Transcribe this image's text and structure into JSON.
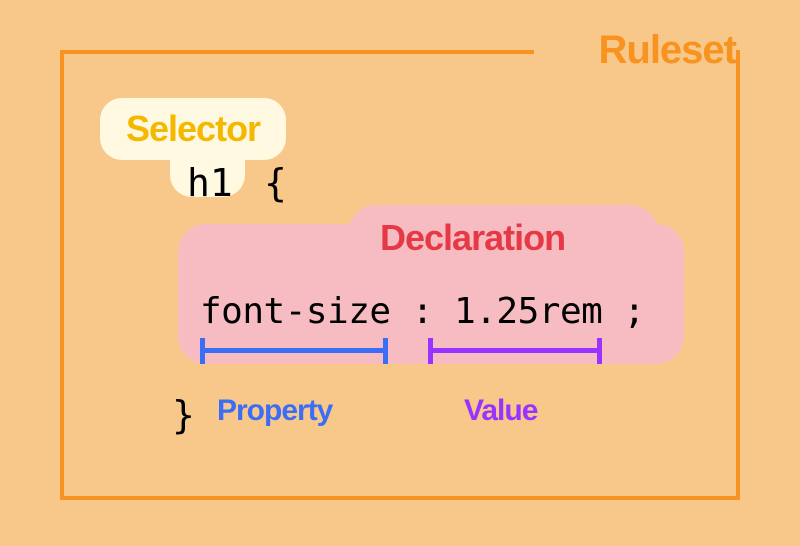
{
  "labels": {
    "ruleset": "Ruleset",
    "selector": "Selector",
    "declaration": "Declaration",
    "property": "Property",
    "value": "Value"
  },
  "code": {
    "selector": "h1",
    "brace_open": "{",
    "declaration": "font-size : 1.25rem ;",
    "brace_close": "}",
    "property": "font-size",
    "value": "1.25rem"
  },
  "colors": {
    "background": "#f8c88a",
    "ruleset_border": "#f7931e",
    "selector_badge_bg": "#fef9e0",
    "selector_text": "#f5b800",
    "declaration_badge_bg": "#f7bcc2",
    "declaration_text": "#e63946",
    "property": "#3b6ef5",
    "value": "#9933ff"
  }
}
